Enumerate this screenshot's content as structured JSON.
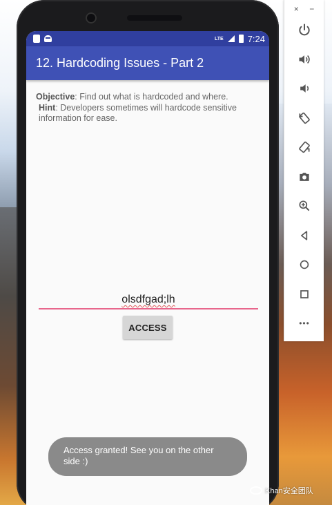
{
  "status_bar": {
    "network_label": "LTE",
    "time": "7:24"
  },
  "app_bar": {
    "title": "12. Hardcoding Issues - Part 2"
  },
  "content": {
    "objective_label": "Objective",
    "objective_text": ": Find out what is hardcoded and where.",
    "hint_label": "Hint",
    "hint_text": ": Developers sometimes will hardcode sensitive information for ease."
  },
  "input": {
    "value": "olsdfgad;lh"
  },
  "access_button": {
    "label": "ACCESS"
  },
  "toast": {
    "message": "Access granted! See you on the other side :)"
  },
  "side_panel": {
    "close_glyph": "×",
    "minimize_glyph": "−",
    "more_glyph": "•••"
  },
  "watermark": {
    "text": "Khan安全团队"
  }
}
